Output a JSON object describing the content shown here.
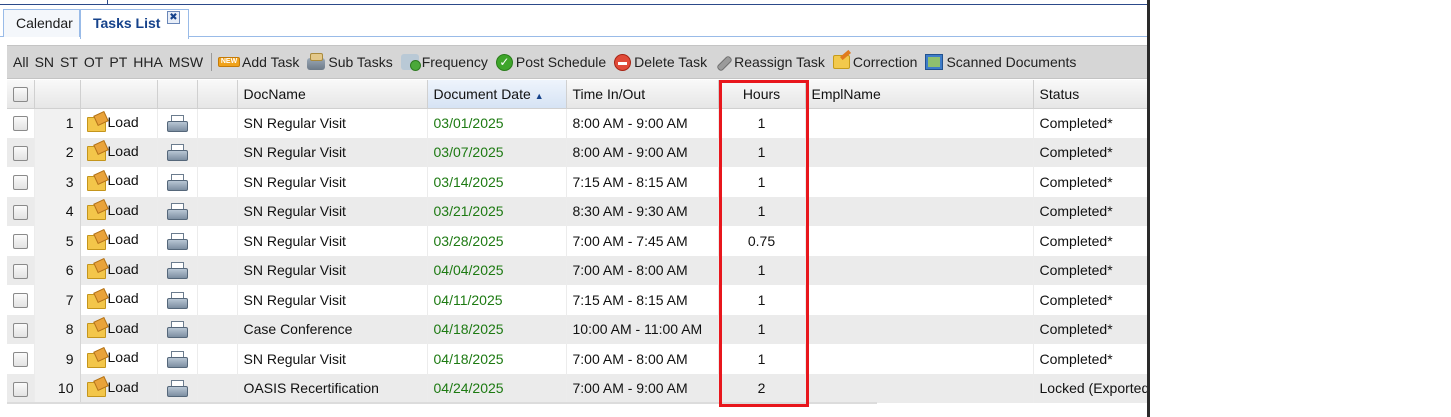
{
  "tabs": [
    {
      "label": "Calendar"
    },
    {
      "label": "Tasks List"
    }
  ],
  "tab_close_glyph": "✖",
  "toolbar": {
    "filters": [
      "All",
      "SN",
      "ST",
      "OT",
      "PT",
      "HHA",
      "MSW"
    ],
    "new_badge": "NEW",
    "actions": [
      {
        "label": "Add Task",
        "icon": "add-task-icon"
      },
      {
        "label": "Sub Tasks",
        "icon": "sub-tasks-icon"
      },
      {
        "label": "Frequency",
        "icon": "frequency-icon"
      },
      {
        "label": "Post Schedule",
        "icon": "post-schedule-icon"
      },
      {
        "label": "Delete Task",
        "icon": "delete-task-icon"
      },
      {
        "label": "Reassign Task",
        "icon": "reassign-task-icon"
      },
      {
        "label": "Correction",
        "icon": "correction-icon"
      },
      {
        "label": "Scanned Documents",
        "icon": "scanned-documents-icon"
      }
    ]
  },
  "grid": {
    "columns": {
      "docname": "DocName",
      "document_date": "Document Date",
      "time": "Time In/Out",
      "hours": "Hours",
      "emplname": "EmplName",
      "status": "Status"
    },
    "sort_indicator": "▲",
    "load_label": "Load",
    "rows": [
      {
        "n": "1",
        "doc": "SN Regular Visit",
        "date": "03/01/2025",
        "time": "8:00 AM - 9:00 AM",
        "hours": "1",
        "empl": "",
        "status": "Completed*"
      },
      {
        "n": "2",
        "doc": "SN Regular Visit",
        "date": "03/07/2025",
        "time": "8:00 AM - 9:00 AM",
        "hours": "1",
        "empl": "",
        "status": "Completed*"
      },
      {
        "n": "3",
        "doc": "SN Regular Visit",
        "date": "03/14/2025",
        "time": "7:15 AM - 8:15 AM",
        "hours": "1",
        "empl": "",
        "status": "Completed*"
      },
      {
        "n": "4",
        "doc": "SN Regular Visit",
        "date": "03/21/2025",
        "time": "8:30 AM - 9:30 AM",
        "hours": "1",
        "empl": "",
        "status": "Completed*"
      },
      {
        "n": "5",
        "doc": "SN Regular Visit",
        "date": "03/28/2025",
        "time": "7:00 AM - 7:45 AM",
        "hours": "0.75",
        "empl": "",
        "status": "Completed*"
      },
      {
        "n": "6",
        "doc": "SN Regular Visit",
        "date": "04/04/2025",
        "time": "7:00 AM - 8:00 AM",
        "hours": "1",
        "empl": "",
        "status": "Completed*"
      },
      {
        "n": "7",
        "doc": "SN Regular Visit",
        "date": "04/11/2025",
        "time": "7:15 AM - 8:15 AM",
        "hours": "1",
        "empl": "",
        "status": "Completed*"
      },
      {
        "n": "8",
        "doc": "Case Conference",
        "date": "04/18/2025",
        "time": "10:00 AM - 11:00 AM",
        "hours": "1",
        "empl": "",
        "status": "Completed*"
      },
      {
        "n": "9",
        "doc": "SN Regular Visit",
        "date": "04/18/2025",
        "time": "7:00 AM - 8:00 AM",
        "hours": "1",
        "empl": "",
        "status": "Completed*"
      },
      {
        "n": "10",
        "doc": "OASIS Recertification",
        "date": "04/24/2025",
        "time": "7:00 AM - 9:00 AM",
        "hours": "2",
        "empl": "",
        "status": "Locked (Exported)"
      }
    ]
  },
  "colors": {
    "date_text": "#1d7a12",
    "highlight_border": "#e8161c",
    "tab_active_text": "#15428b"
  }
}
